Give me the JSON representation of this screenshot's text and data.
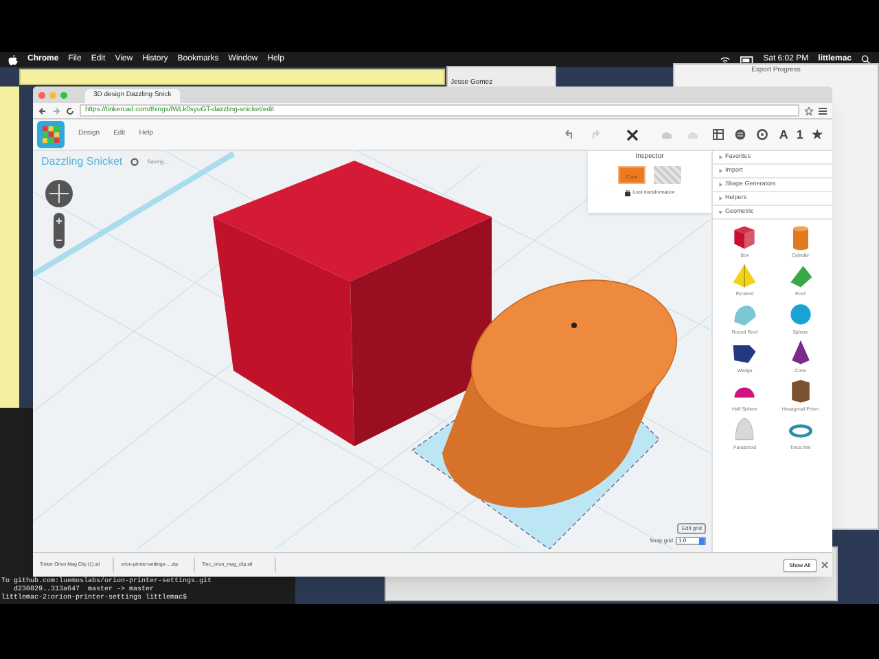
{
  "menu_bar": {
    "app": "Chrome",
    "items": [
      "File",
      "Edit",
      "View",
      "History",
      "Bookmarks",
      "Window",
      "Help"
    ],
    "clock": "Sat 6:02 PM",
    "user": "littlemac"
  },
  "background_windows": {
    "chat_contact": "Jesse Gomez",
    "export_title": "Export Progress"
  },
  "browser": {
    "tab": "3D design Dazzling Snick",
    "url": "https://tinkercad.com/things/fWLk0syuGT-dazzling-snicket/edit"
  },
  "app": {
    "menu": [
      "Design",
      "Edit",
      "Help"
    ],
    "title": "Dazzling Snicket",
    "save_status": "Saving..."
  },
  "inspector": {
    "title": "Inspector",
    "color_label": "Color",
    "lock_label": "Lock transformation"
  },
  "library": {
    "top_icons": [
      "A",
      "1",
      "★"
    ],
    "sections": [
      {
        "label": "Favorites",
        "expanded": false
      },
      {
        "label": "Import",
        "expanded": false
      },
      {
        "label": "Shape Generators",
        "expanded": false
      },
      {
        "label": "Helpers",
        "expanded": false
      },
      {
        "label": "Geometric",
        "expanded": true
      }
    ],
    "shapes": [
      {
        "label": "Box",
        "kind": "box",
        "color": "#c8102e"
      },
      {
        "label": "Cylinder",
        "kind": "cylinder",
        "color": "#e07a1f"
      },
      {
        "label": "Pyramid",
        "kind": "pyramid",
        "color": "#f2d21b"
      },
      {
        "label": "Roof",
        "kind": "roof",
        "color": "#3aa845"
      },
      {
        "label": "Round Roof",
        "kind": "roundroof",
        "color": "#7cc6d6"
      },
      {
        "label": "Sphere",
        "kind": "sphere",
        "color": "#1aa3d4"
      },
      {
        "label": "Wedge",
        "kind": "wedge",
        "color": "#233a80"
      },
      {
        "label": "Cone",
        "kind": "cone",
        "color": "#7a2a8c"
      },
      {
        "label": "Half Sphere",
        "kind": "halfsphere",
        "color": "#d0127f"
      },
      {
        "label": "Hexagonal Prism",
        "kind": "hexprism",
        "color": "#7a5232"
      },
      {
        "label": "Paraboloid",
        "kind": "paraboloid",
        "color": "#d8d8d8"
      },
      {
        "label": "Torus thin",
        "kind": "torus",
        "color": "#2a8fa8"
      }
    ]
  },
  "canvas": {
    "edit_grid": "Edit grid",
    "snap_label": "Snap grid",
    "snap_value": "1.0"
  },
  "downloads": {
    "files": [
      "Tinker Orion Mag Clip (1).stl",
      "orion-printer-settings-....zip",
      "Tinc_orion_mag_clip.stl"
    ],
    "show_all": "Show All"
  },
  "terminal": {
    "lines": [
      "To github.com:luemoslabs/orion-printer-settings.git",
      "   d230829..313a647  master -> master",
      "littlemac-2:orion-printer-settings littlemac$"
    ]
  }
}
